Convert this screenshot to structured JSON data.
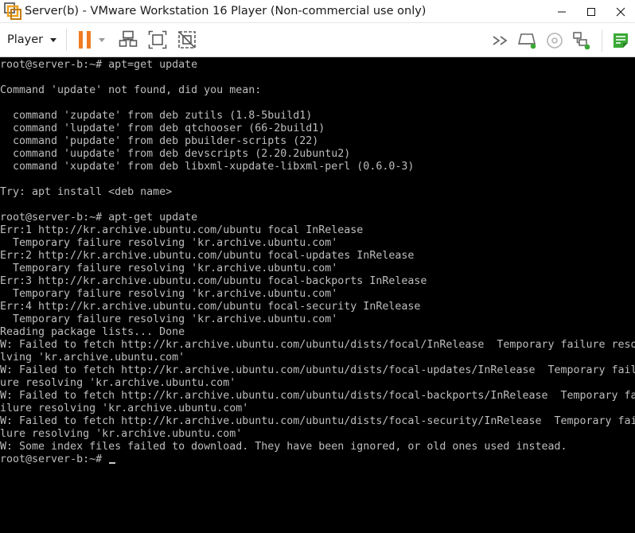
{
  "window": {
    "title": "Server(b) - VMware Workstation 16 Player (Non-commercial use only)",
    "controls": {
      "minimize": "—",
      "maximize": "☐",
      "close": "✕"
    }
  },
  "toolbar": {
    "player_menu_label": "Player",
    "accent_color": "#f07b22",
    "icons": [
      "pause-icon",
      "send-ctrl-alt-del-icon",
      "fit-guest-icon",
      "unity-icon",
      "forward-icon",
      "hard-disk-icon",
      "cd-icon",
      "network-icon",
      "message-icon"
    ]
  },
  "terminal": {
    "lines": [
      "root@server-b:~# apt=get update",
      "",
      "Command 'update' not found, did you mean:",
      "",
      "  command 'zupdate' from deb zutils (1.8-5build1)",
      "  command 'lupdate' from deb qtchooser (66-2build1)",
      "  command 'pupdate' from deb pbuilder-scripts (22)",
      "  command 'uupdate' from deb devscripts (2.20.2ubuntu2)",
      "  command 'xupdate' from deb libxml-xupdate-libxml-perl (0.6.0-3)",
      "",
      "Try: apt install <deb name>",
      "",
      "root@server-b:~# apt-get update",
      "Err:1 http://kr.archive.ubuntu.com/ubuntu focal InRelease",
      "  Temporary failure resolving 'kr.archive.ubuntu.com'",
      "Err:2 http://kr.archive.ubuntu.com/ubuntu focal-updates InRelease",
      "  Temporary failure resolving 'kr.archive.ubuntu.com'",
      "Err:3 http://kr.archive.ubuntu.com/ubuntu focal-backports InRelease",
      "  Temporary failure resolving 'kr.archive.ubuntu.com'",
      "Err:4 http://kr.archive.ubuntu.com/ubuntu focal-security InRelease",
      "  Temporary failure resolving 'kr.archive.ubuntu.com'",
      "Reading package lists... Done",
      "W: Failed to fetch http://kr.archive.ubuntu.com/ubuntu/dists/focal/InRelease  Temporary failure reso",
      "lving 'kr.archive.ubuntu.com'",
      "W: Failed to fetch http://kr.archive.ubuntu.com/ubuntu/dists/focal-updates/InRelease  Temporary fail",
      "ure resolving 'kr.archive.ubuntu.com'",
      "W: Failed to fetch http://kr.archive.ubuntu.com/ubuntu/dists/focal-backports/InRelease  Temporary fa",
      "ilure resolving 'kr.archive.ubuntu.com'",
      "W: Failed to fetch http://kr.archive.ubuntu.com/ubuntu/dists/focal-security/InRelease  Temporary fai",
      "lure resolving 'kr.archive.ubuntu.com'",
      "W: Some index files failed to download. They have been ignored, or old ones used instead."
    ],
    "prompt": "root@server-b:~# ",
    "text_color": "#bebebe",
    "background_color": "#000000"
  }
}
